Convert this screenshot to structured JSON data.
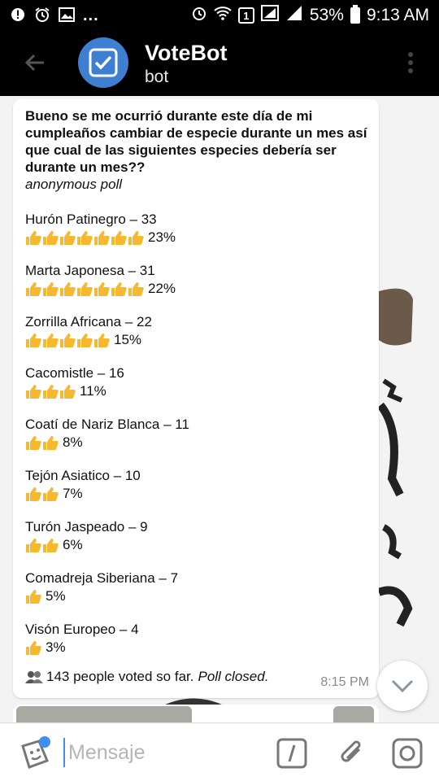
{
  "status_bar": {
    "battery": "53%",
    "time": "9:13 AM",
    "sim_badge": "1",
    "dots": "..."
  },
  "header": {
    "title": "VoteBot",
    "subtitle": "bot"
  },
  "poll": {
    "question": "Bueno se me ocurrió durante este día de mi cumpleaños cambiar de especie durante un mes así que cual  de las siguientes especies debería ser durante un mes??",
    "kind": "anonymous poll",
    "options": [
      {
        "label": "Hurón Patinegro – 33",
        "thumbs": 7,
        "percent": "23%"
      },
      {
        "label": "Marta Japonesa – 31",
        "thumbs": 7,
        "percent": "22%"
      },
      {
        "label": "Zorrilla Africana – 22",
        "thumbs": 5,
        "percent": "15%"
      },
      {
        "label": "Cacomistle – 16",
        "thumbs": 3,
        "percent": "11%"
      },
      {
        "label": "Coatí de Nariz Blanca – 11",
        "thumbs": 2,
        "percent": "8%"
      },
      {
        "label": "Tejón Asiatico – 10",
        "thumbs": 2,
        "percent": "7%"
      },
      {
        "label": "Turón Jaspeado – 9",
        "thumbs": 2,
        "percent": "6%"
      },
      {
        "label": "Comadreja Siberiana – 7",
        "thumbs": 1,
        "percent": "5%"
      },
      {
        "label": "Visón Europeo – 4",
        "thumbs": 1,
        "percent": "3%"
      }
    ],
    "footer_votes": "143 people voted so far.",
    "footer_closed": "Poll closed.",
    "time": "8:15 PM"
  },
  "input": {
    "placeholder": "Mensaje"
  },
  "colors": {
    "accent": "#3f8ef0",
    "avatar": "#3f7fd1",
    "thumb": "#f5b82e"
  },
  "icons": [
    "back-arrow-icon",
    "ballot-check-icon",
    "more-vert-icon",
    "people-icon",
    "thumbs-up-icon",
    "chevron-down-icon",
    "sticker-icon",
    "slash-command-icon",
    "attach-icon",
    "camera-icon"
  ]
}
